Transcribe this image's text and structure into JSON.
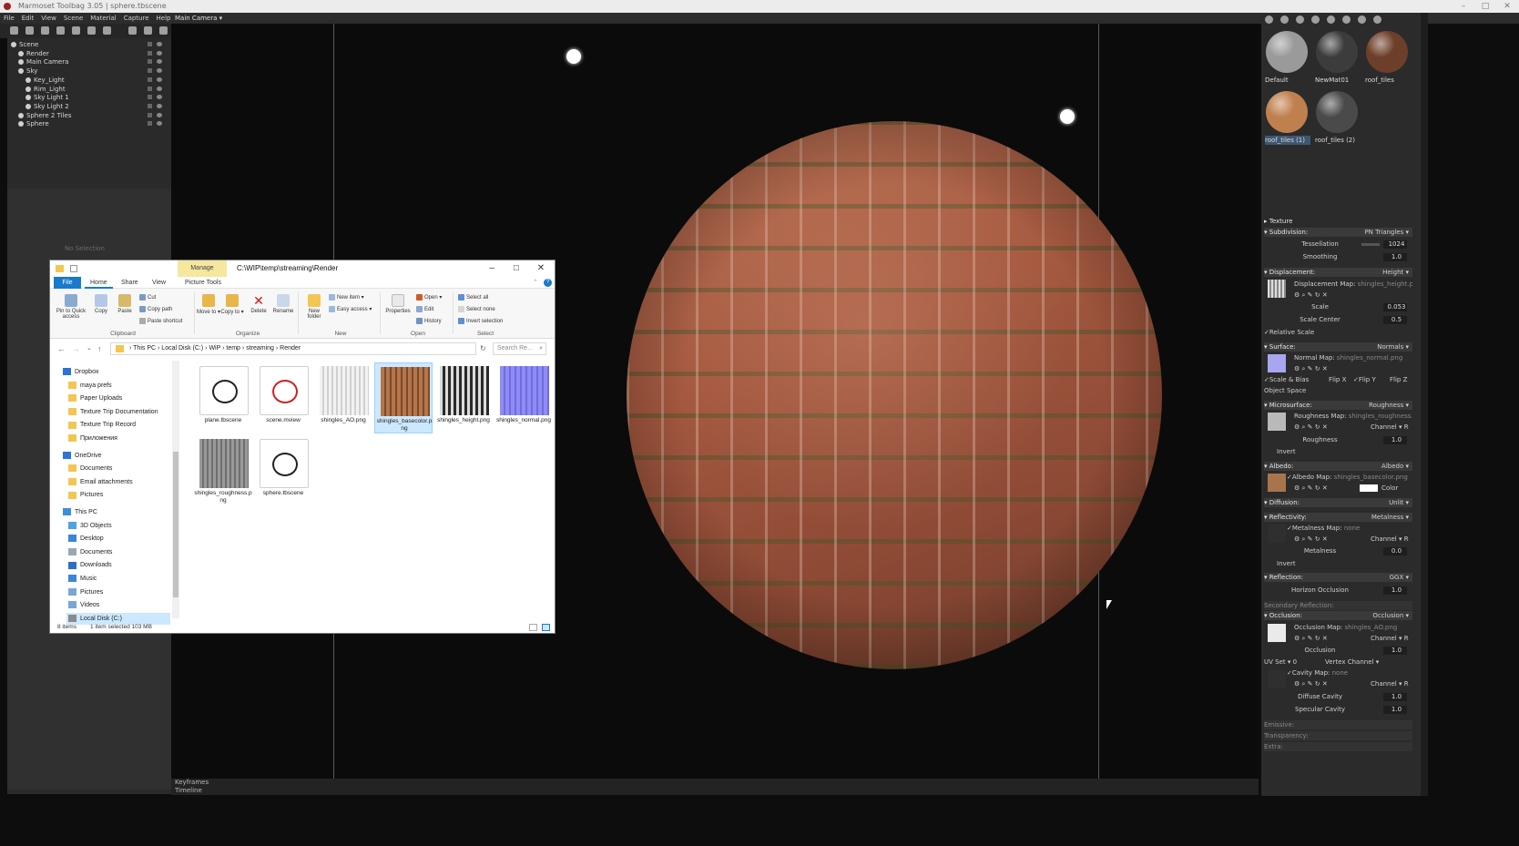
{
  "window": {
    "title": "Marmoset Toolbag 3.05 | sphere.tbscene",
    "controls": [
      "–",
      "□",
      "✕"
    ]
  },
  "menubar": {
    "items": [
      "File",
      "Edit",
      "View",
      "Scene",
      "Material",
      "Capture",
      "Help"
    ],
    "camera": "Main Camera ▾"
  },
  "scene_tree": {
    "items": [
      {
        "label": "Scene",
        "indent": 0
      },
      {
        "label": "Render",
        "indent": 1
      },
      {
        "label": "Main Camera",
        "indent": 1
      },
      {
        "label": "Sky",
        "indent": 1
      },
      {
        "label": "Key_Light",
        "indent": 2
      },
      {
        "label": "Rim_Light",
        "indent": 2
      },
      {
        "label": "Sky Light 1",
        "indent": 2
      },
      {
        "label": "Sky Light 2",
        "indent": 2
      },
      {
        "label": "Sphere 2 Tiles",
        "indent": 1
      },
      {
        "label": "Sphere",
        "indent": 1
      }
    ],
    "no_selection": "No Selection"
  },
  "viewport": {
    "bottom_tabs": [
      "Keyframes",
      "Timeline"
    ]
  },
  "materials": [
    {
      "label": "Default",
      "color": "#9a9a9a"
    },
    {
      "label": "NewMat01",
      "color": "#3c3c3c"
    },
    {
      "label": "roof_tiles",
      "color": "#6d3f2a"
    },
    {
      "label": "roof_tiles (1)",
      "color": "#c0804e",
      "selected": true
    },
    {
      "label": "roof_tiles (2)",
      "color": "#4a4a4a"
    }
  ],
  "material_editor": {
    "texture": "Texture",
    "subdivision": {
      "title": "Subdivision:",
      "mode": "PN Triangles ▾",
      "tessellation_label": "Tessellation",
      "tessellation": "1024",
      "smoothing_label": "Smoothing",
      "smoothing": "1.0"
    },
    "displacement": {
      "title": "Displacement:",
      "mode": "Height ▾",
      "map_label": "Displacement Map:",
      "map": "shingles_height.png",
      "scale_label": "Scale",
      "scale": "0.053",
      "scale_center_label": "Scale Center",
      "scale_center": "0.5",
      "relative_scale": "✓Relative Scale"
    },
    "surface": {
      "title": "Surface:",
      "mode": "Normals ▾",
      "map_label": "Normal Map:",
      "map": "shingles_normal.png",
      "scale_bias": "✓Scale & Bias",
      "flip_x": "Flip X",
      "flip_y": "✓Flip Y",
      "flip_z": "Flip Z",
      "object_space": "Object Space"
    },
    "microsurface": {
      "title": "Microsurface:",
      "mode": "Roughness ▾",
      "map_label": "Roughness Map:",
      "map": "shingles_roughness.png",
      "channel": "Channel ▾ R",
      "roughness_label": "Roughness",
      "roughness": "1.0",
      "invert": "Invert"
    },
    "albedo": {
      "title": "Albedo:",
      "mode": "Albedo ▾",
      "map_label": "✓Albedo Map:",
      "map": "shingles_basecolor.png",
      "color": "Color"
    },
    "diffusion": {
      "title": "Diffusion:",
      "mode": "Unlit ▾"
    },
    "reflectivity": {
      "title": "Reflectivity:",
      "mode": "Metalness ▾",
      "map_label": "✓Metalness Map:",
      "map": "none",
      "channel": "Channel ▾ R",
      "metalness_label": "Metalness",
      "metalness": "0.0",
      "invert": "Invert"
    },
    "reflection": {
      "title": "Reflection:",
      "mode": "GGX ▾",
      "horizon_label": "Horizon Occlusion",
      "horizon": "1.0"
    },
    "secondary_reflection": "Secondary Reflection:",
    "occlusion": {
      "title": "Occlusion:",
      "mode": "Occlusion ▾",
      "map_label": "Occlusion Map:",
      "map": "shingles_AO.png",
      "channel": "Channel ▾ R",
      "occlusion_label": "Occlusion",
      "occlusion": "1.0",
      "uv_set": "UV Set ▾ 0",
      "vertex_channel": "Vertex Channel ▾",
      "cavity_label": "✓Cavity Map:",
      "cavity_map": "none",
      "channel2": "Channel ▾ R",
      "diffuse_cavity_label": "Diffuse Cavity",
      "diffuse_cavity": "1.0",
      "specular_cavity_label": "Specular Cavity",
      "specular_cavity": "1.0"
    },
    "emissive": "Emissive:",
    "transparency": "Transparency:",
    "extra": "Extra:"
  },
  "explorer": {
    "manage": "Manage",
    "path": "C:\\WIP\\temp\\streaming\\Render",
    "tabs": [
      "File",
      "Home",
      "Share",
      "View",
      "Picture Tools"
    ],
    "ribbon": {
      "pin": "Pin to Quick access",
      "copy": "Copy",
      "paste": "Paste",
      "cut": "Cut",
      "copy_path": "Copy path",
      "paste_shortcut": "Paste shortcut",
      "move_to": "Move to ▾",
      "copy_to": "Copy to ▾",
      "delete": "Delete",
      "rename": "Rename",
      "new_folder": "New folder",
      "new_item": "New item ▾",
      "easy_access": "Easy access ▾",
      "properties": "Properties",
      "open": "Open ▾",
      "edit": "Edit",
      "history": "History",
      "select_all": "Select all",
      "select_none": "Select none",
      "invert_selection": "Invert selection",
      "groups": [
        "Clipboard",
        "Organize",
        "New",
        "Open",
        "Select"
      ]
    },
    "breadcrumb": [
      "This PC",
      "Local Disk (C:)",
      "WiP",
      "temp",
      "streaming",
      "Render"
    ],
    "search_placeholder": "Search Re...",
    "nav": [
      {
        "label": "Dropbox",
        "indent": 0,
        "color": "#2b73d6"
      },
      {
        "label": "maya prefs",
        "indent": 1,
        "color": "#f2c652"
      },
      {
        "label": "Paper Uploads",
        "indent": 1,
        "color": "#f2c652"
      },
      {
        "label": "Texture Trip Documentation",
        "indent": 1,
        "color": "#f2c652"
      },
      {
        "label": "Texture Trip Record",
        "indent": 1,
        "color": "#f2c652"
      },
      {
        "label": "Приложения",
        "indent": 1,
        "color": "#f2c652"
      },
      {
        "label": "OneDrive",
        "indent": 0,
        "color": "#2b73d6"
      },
      {
        "label": "Documents",
        "indent": 1,
        "color": "#f2c652"
      },
      {
        "label": "Email attachments",
        "indent": 1,
        "color": "#f2c652"
      },
      {
        "label": "Pictures",
        "indent": 1,
        "color": "#f2c652"
      },
      {
        "label": "This PC",
        "indent": 0,
        "color": "#3b8fd9"
      },
      {
        "label": "3D Objects",
        "indent": 1,
        "color": "#4fa3e0"
      },
      {
        "label": "Desktop",
        "indent": 1,
        "color": "#3c86d4"
      },
      {
        "label": "Documents",
        "indent": 1,
        "color": "#9aa7b4"
      },
      {
        "label": "Downloads",
        "indent": 1,
        "color": "#2e6fc0"
      },
      {
        "label": "Music",
        "indent": 1,
        "color": "#3c86d4"
      },
      {
        "label": "Pictures",
        "indent": 1,
        "color": "#7aa6d6"
      },
      {
        "label": "Videos",
        "indent": 1,
        "color": "#7aa6d6"
      },
      {
        "label": "Local Disk (C:)",
        "indent": 1,
        "color": "#8a8a8a",
        "selected": true
      }
    ],
    "files": [
      {
        "name": "plane.tbscene",
        "kind": "scene"
      },
      {
        "name": "scene.mview",
        "kind": "mview"
      },
      {
        "name": "shingles_AO.png",
        "kind": "ao"
      },
      {
        "name": "shingles_basecolor.png",
        "kind": "base",
        "selected": true
      },
      {
        "name": "shingles_height.png",
        "kind": "height"
      },
      {
        "name": "shingles_normal.png",
        "kind": "normal"
      },
      {
        "name": "shingles_roughness.png",
        "kind": "rough"
      },
      {
        "name": "sphere.tbscene",
        "kind": "scene"
      }
    ],
    "status": {
      "count": "8 items",
      "selected": "1 item selected  103 MB"
    }
  }
}
